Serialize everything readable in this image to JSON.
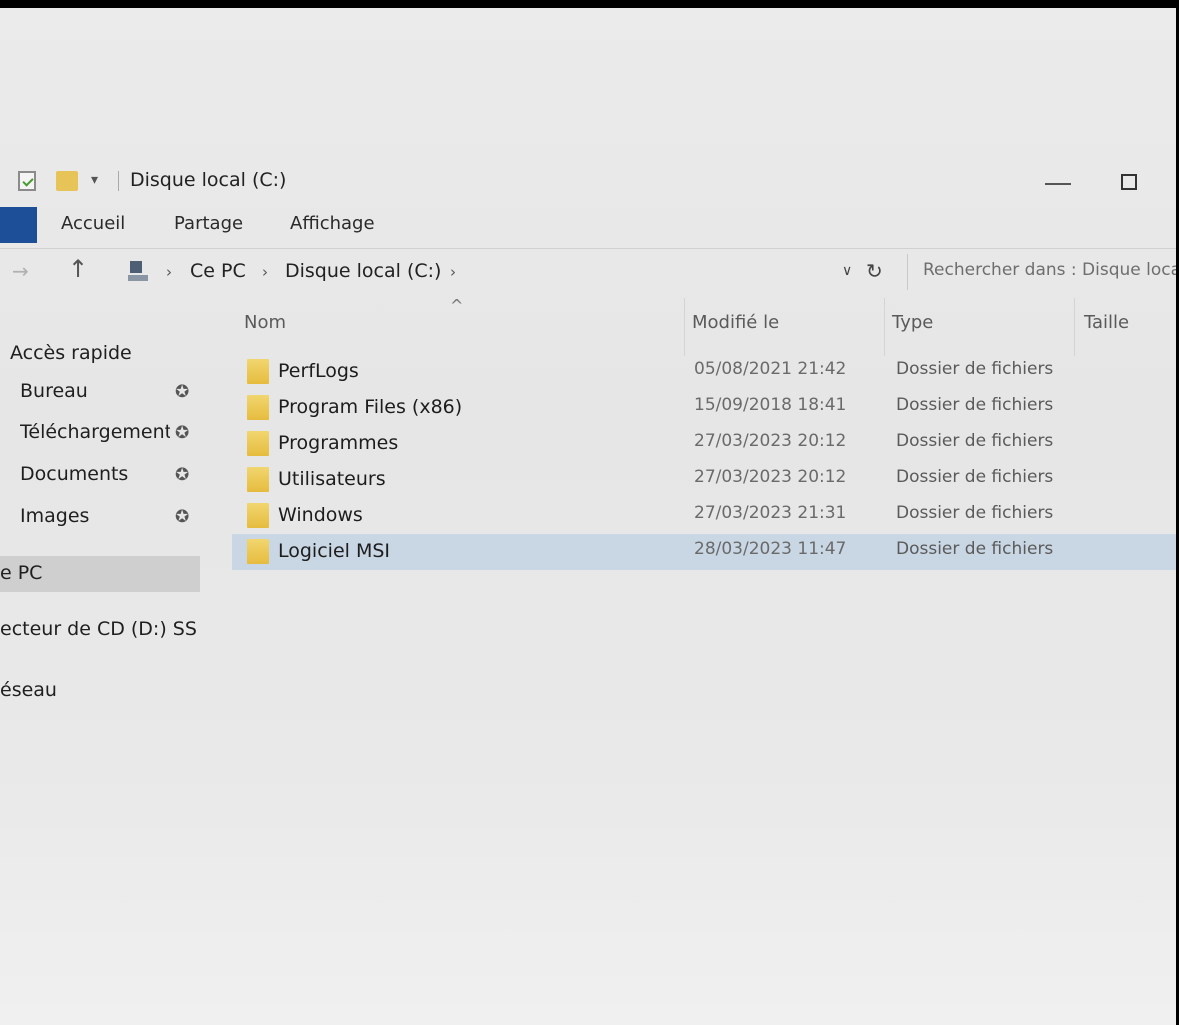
{
  "window": {
    "title": "Disque local (C:)"
  },
  "ribbon": {
    "tabs": [
      "Accueil",
      "Partage",
      "Affichage"
    ]
  },
  "address": {
    "breadcrumb": [
      "Ce PC",
      "Disque local (C:)"
    ],
    "search_placeholder": "Rechercher dans : Disque loca..."
  },
  "sidebar": {
    "quick_access": "Accès rapide",
    "pinned": [
      "Bureau",
      "Téléchargements",
      "Documents",
      "Images"
    ],
    "this_pc": "e PC",
    "cd_drive": "ecteur de CD (D:) SS",
    "network": "éseau"
  },
  "columns": {
    "name": "Nom",
    "modified": "Modifié le",
    "type": "Type",
    "size": "Taille"
  },
  "files": [
    {
      "name": "PerfLogs",
      "modified": "05/08/2021 21:42",
      "type": "Dossier de fichiers"
    },
    {
      "name": "Program Files (x86)",
      "modified": "15/09/2018 18:41",
      "type": "Dossier de fichiers"
    },
    {
      "name": "Programmes",
      "modified": "27/03/2023 20:12",
      "type": "Dossier de fichiers"
    },
    {
      "name": "Utilisateurs",
      "modified": "27/03/2023 20:12",
      "type": "Dossier de fichiers"
    },
    {
      "name": "Windows",
      "modified": "27/03/2023 21:31",
      "type": "Dossier de fichiers"
    },
    {
      "name": "Logiciel MSI",
      "modified": "28/03/2023 11:47",
      "type": "Dossier de fichiers"
    }
  ],
  "selected_file": "Logiciel MSI",
  "icons": {
    "pin": "pin-icon",
    "folder": "folder-icon",
    "pc": "pc-icon"
  },
  "colors": {
    "file_tab": "#1c4f97",
    "selection": "#c9d6e3",
    "folder": "#e6bc3e"
  }
}
